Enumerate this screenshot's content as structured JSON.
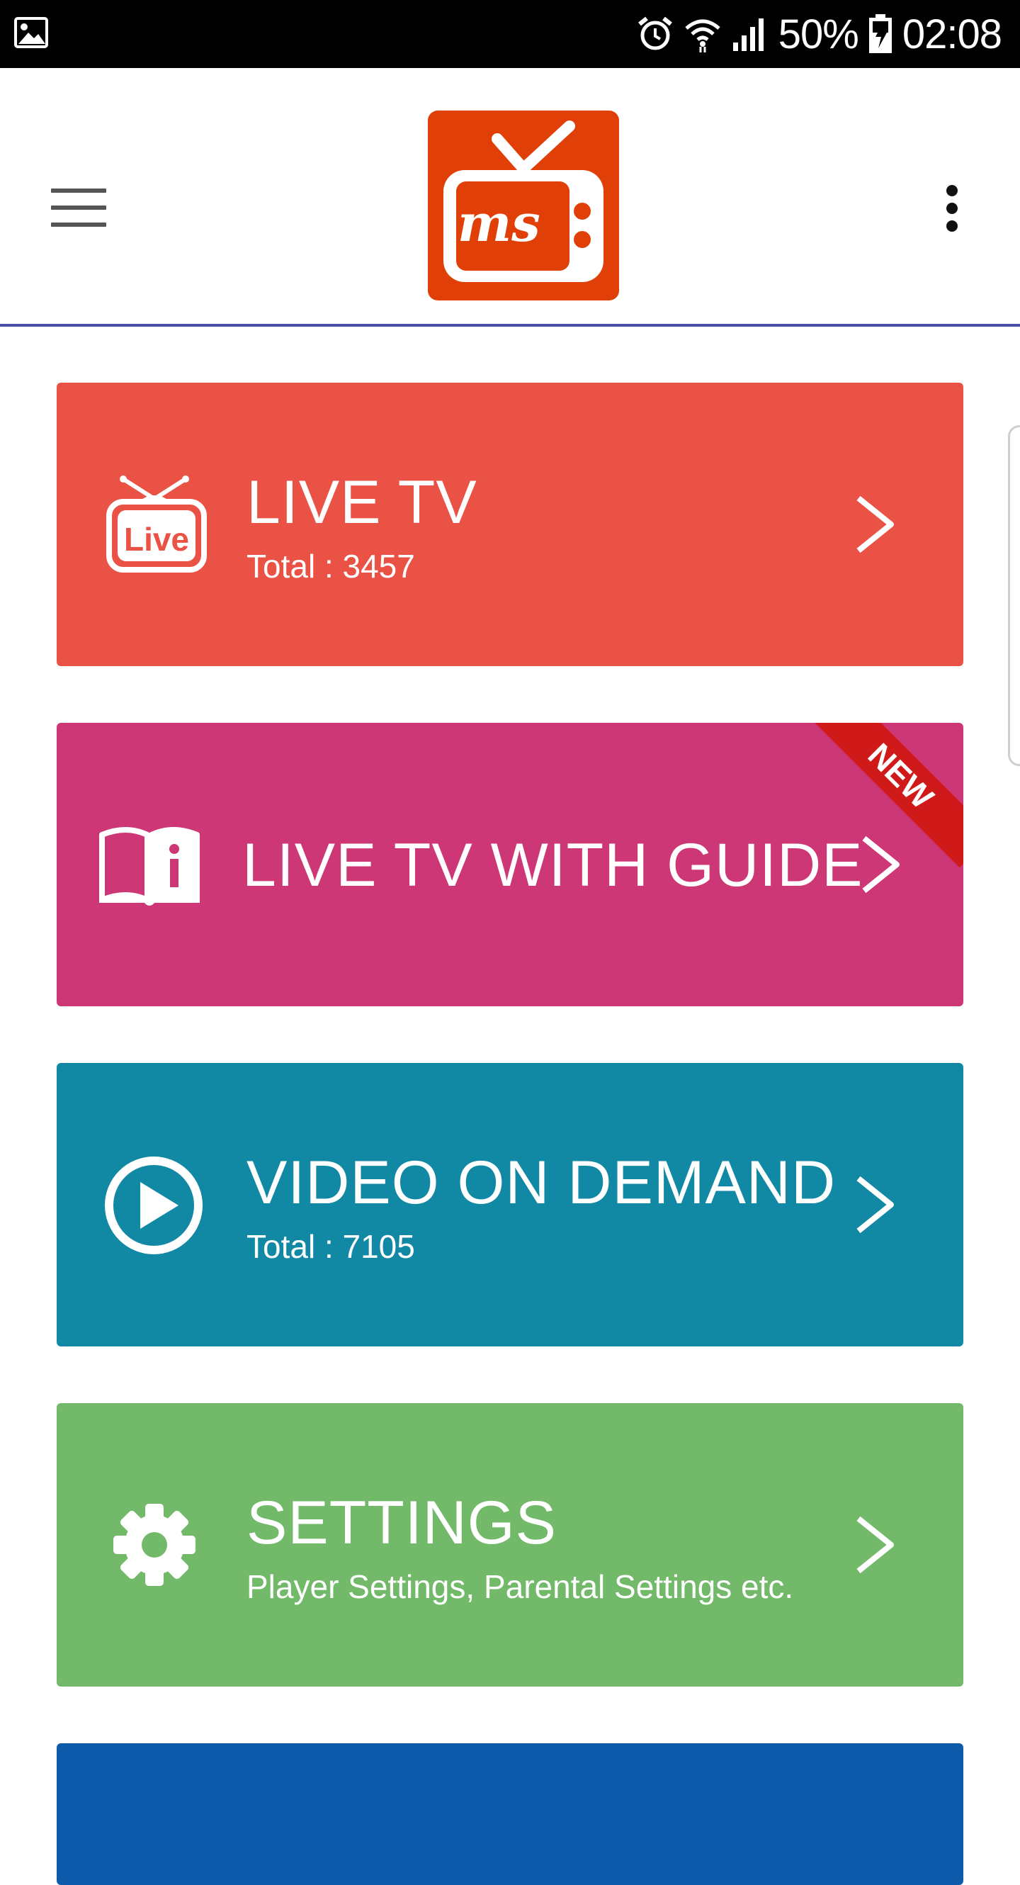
{
  "status_bar": {
    "battery": "50%",
    "time": "02:08"
  },
  "app_bar": {
    "logo_text": "ms"
  },
  "menu": [
    {
      "title": "LIVE TV",
      "subtitle": "Total : 3457",
      "color": "#ea5246",
      "icon": "live-tv-icon"
    },
    {
      "title": "LIVE TV WITH GUIDE",
      "subtitle": "",
      "color": "#ce3776",
      "icon": "guide-book-icon",
      "badge": "NEW",
      "badge_color": "#d01a1a"
    },
    {
      "title": "VIDEO ON DEMAND",
      "subtitle": "Total : 7105",
      "color": "#1289a4",
      "icon": "play-icon"
    },
    {
      "title": "SETTINGS",
      "subtitle": "Player Settings, Parental Settings etc.",
      "color": "#73b96a",
      "icon": "gear-icon"
    },
    {
      "title": "",
      "subtitle": "",
      "color": "#0d5aab",
      "icon": ""
    }
  ],
  "colors": {
    "status_bar": "#000000",
    "app_bar_border": "#4a4fa6",
    "logo": "#e04008"
  }
}
